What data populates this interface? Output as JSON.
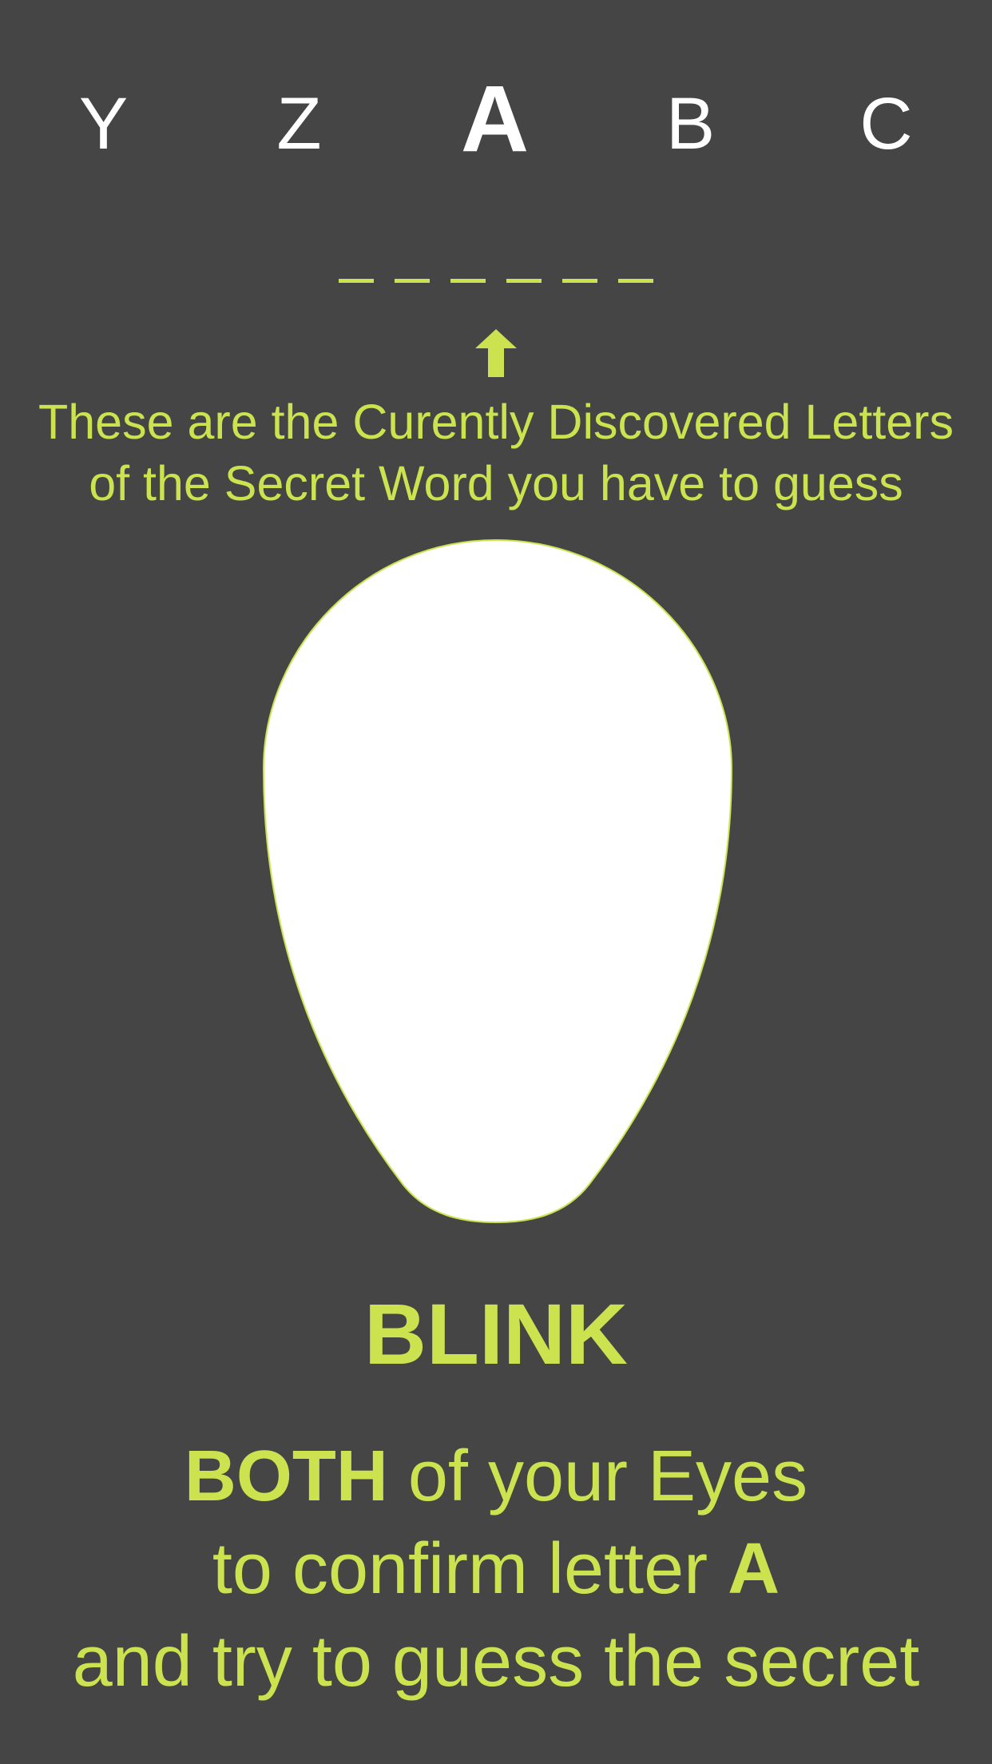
{
  "letters": {
    "items": [
      "Y",
      "Z",
      "A",
      "B",
      "C"
    ],
    "selected_index": 2
  },
  "secret_word": {
    "slot_count": 6,
    "slots": [
      "_",
      "_",
      "_",
      "_",
      "_",
      "_"
    ]
  },
  "hint": {
    "line1": "These are the Curently Discovered Letters",
    "line2": "of the Secret Word you have to guess"
  },
  "blink": {
    "title": "BLINK"
  },
  "instructions": {
    "emphasis": "BOTH",
    "line1_rest": " of your Eyes",
    "line2_prefix": "to confirm letter ",
    "letter": "A",
    "line3": "and try to guess the secret"
  },
  "colors": {
    "background": "#454545",
    "accent": "#cce34f",
    "foreground": "#ffffff"
  },
  "icons": {
    "arrow": "arrow-up-icon",
    "face": "face-outline-icon"
  }
}
